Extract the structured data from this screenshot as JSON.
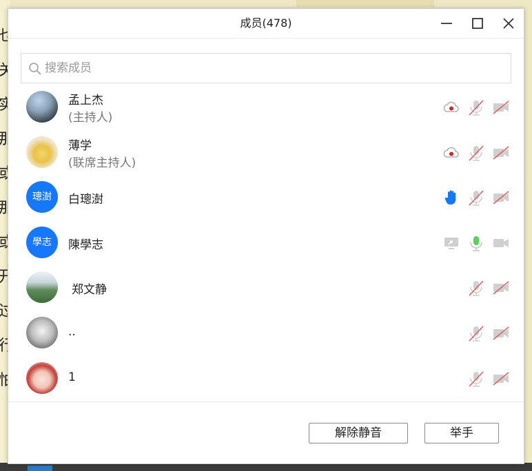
{
  "window": {
    "title": "成员(478)"
  },
  "search": {
    "placeholder": "搜索成员",
    "value": ""
  },
  "members": [
    {
      "name": "孟上杰",
      "role": "(主持人)",
      "avatar": "photo",
      "status": "recording",
      "mic": "muted",
      "camera": "off"
    },
    {
      "name": "薄学",
      "role": "(联席主持人)",
      "avatar": "photo",
      "status": "recording",
      "mic": "muted",
      "camera": "off"
    },
    {
      "name": "白璁澍",
      "role": "",
      "avatar_text": "璁澍",
      "status": "hand-raised",
      "mic": "muted",
      "camera": "off"
    },
    {
      "name": "陳學志",
      "role": "",
      "avatar_text": "學志",
      "status": "screen-share",
      "mic": "speaking",
      "camera": "off"
    },
    {
      "name": "郑文静",
      "role": "",
      "avatar": "photo",
      "status": "",
      "mic": "muted",
      "camera": "off"
    },
    {
      "name": "..",
      "role": "",
      "avatar": "photo",
      "status": "",
      "mic": "muted",
      "camera": "off"
    },
    {
      "name": "1",
      "role": "",
      "avatar": "photo",
      "status": "",
      "mic": "muted",
      "camera": "off"
    }
  ],
  "footer": {
    "unmute_label": "解除静音",
    "raise_hand_label": "举手"
  },
  "colors": {
    "accent": "#1677ff",
    "mic_active": "#55d455",
    "muted_slash": "#e06060",
    "record_dot": "#e02020"
  },
  "background": {
    "chars": [
      "乜",
      "关",
      "实",
      "那",
      "或",
      "那",
      "或",
      "开",
      "过",
      "行",
      "怕"
    ]
  }
}
